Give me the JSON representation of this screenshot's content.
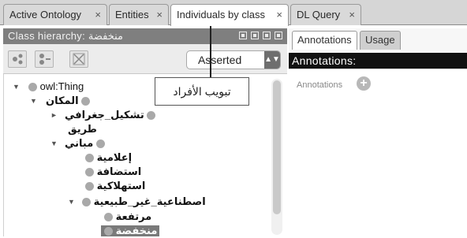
{
  "tabs": [
    {
      "label": "Active Ontology",
      "close": "×"
    },
    {
      "label": "Entities",
      "close": "×"
    },
    {
      "label": "Individuals by class",
      "close": "×"
    },
    {
      "label": "DL Query",
      "close": "×"
    }
  ],
  "class_hierarchy": {
    "title": "Class hierarchy: منخفضة",
    "view_mode": "Asserted",
    "icons": [
      "add-subclass-icon",
      "add-sibling-icon",
      "delete-class-icon"
    ]
  },
  "tree": {
    "root": "owl:Thing",
    "place": "المكان",
    "geo": "تشكيل_جغرافي",
    "road": "طريق",
    "buildings": "مباني",
    "media": "إعلامية",
    "hosting": "استضافة",
    "consumer": "استهلاكية",
    "artificial": "اصطناعية_غير_طبيعية",
    "high": "مرتفعة",
    "low": "منخفضة"
  },
  "callout": "تبويب الأفراد",
  "right": {
    "tab_annotations": "Annotations",
    "tab_usage": "Usage",
    "header": "Annotations:",
    "ann_label": "Annotations",
    "add_icon": "+"
  }
}
